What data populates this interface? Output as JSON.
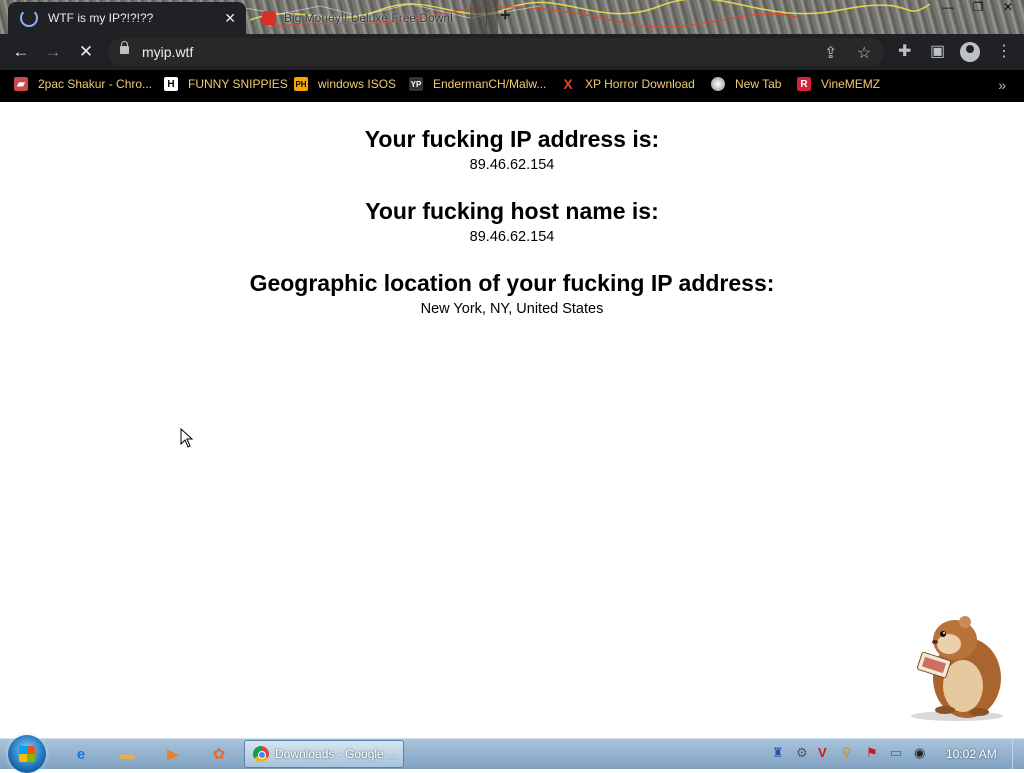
{
  "browser": {
    "active_tab_title": "WTF is my IP?!?!??",
    "inactive_tab_title": "Big Money!! Deluxe Free Downl...",
    "address": "myip.wtf"
  },
  "bookmarks": [
    {
      "label": "2pac Shakur - Chro...",
      "icon": "bookmark-icon",
      "color": "#f2ca74"
    },
    {
      "label": "FUNNY SNIPPIES",
      "icon": "h-icon",
      "color": "#f2ca74"
    },
    {
      "label": "windows ISOS",
      "icon": "ph-icon",
      "color": "#f2ca74"
    },
    {
      "label": "EndermanCH/Malw...",
      "icon": "yp-icon",
      "color": "#f2ca74"
    },
    {
      "label": "XP Horror Download",
      "icon": "x-icon",
      "color": "#f2ca74"
    },
    {
      "label": "New Tab",
      "icon": "globe-icon",
      "color": "#f2ca74"
    },
    {
      "label": "VineMEMZ",
      "icon": "r-icon",
      "color": "#f2ca74"
    }
  ],
  "page": {
    "ip_heading": "Your fucking IP address is:",
    "ip_value": "89.46.62.154",
    "host_heading": "Your fucking host name is:",
    "host_value": "89.46.62.154",
    "geo_heading": "Geographic location of your fucking IP address:",
    "geo_value": "New York, NY, United States"
  },
  "taskbar": {
    "window_label": "Downloads - Google ...",
    "clock": "10:02 AM"
  }
}
